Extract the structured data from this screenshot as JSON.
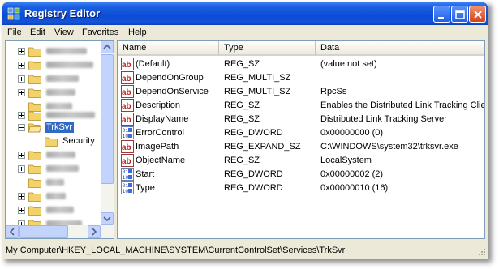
{
  "window": {
    "title": "Registry Editor",
    "title_color": "#ffffff",
    "titlebar_color": "#0a4cd6"
  },
  "menu": [
    "File",
    "Edit",
    "View",
    "Favorites",
    "Help"
  ],
  "tree": {
    "selected_key": "TrkSvr",
    "child_key": "Security",
    "selection_color": "#316ac5",
    "note": ""
  },
  "list": {
    "columns": [
      "Name",
      "Type",
      "Data"
    ],
    "rows": [
      {
        "icon": "string-value-icon",
        "name": "(Default)",
        "type": "REG_SZ",
        "data": "(value not set)"
      },
      {
        "icon": "string-value-icon",
        "name": "DependOnGroup",
        "type": "REG_MULTI_SZ",
        "data": ""
      },
      {
        "icon": "string-value-icon",
        "name": "DependOnService",
        "type": "REG_MULTI_SZ",
        "data": "RpcSs"
      },
      {
        "icon": "string-value-icon",
        "name": "Description",
        "type": "REG_SZ",
        "data": "Enables the Distributed Link Tracking Client"
      },
      {
        "icon": "string-value-icon",
        "name": "DisplayName",
        "type": "REG_SZ",
        "data": "Distributed Link Tracking Server"
      },
      {
        "icon": "binary-value-icon",
        "name": "ErrorControl",
        "type": "REG_DWORD",
        "data": "0x00000000 (0)"
      },
      {
        "icon": "string-value-icon",
        "name": "ImagePath",
        "type": "REG_EXPAND_SZ",
        "data": "C:\\WINDOWS\\system32\\trksvr.exe"
      },
      {
        "icon": "string-value-icon",
        "name": "ObjectName",
        "type": "REG_SZ",
        "data": "LocalSystem"
      },
      {
        "icon": "binary-value-icon",
        "name": "Start",
        "type": "REG_DWORD",
        "data": "0x00000002 (2)"
      },
      {
        "icon": "binary-value-icon",
        "name": "Type",
        "type": "REG_DWORD",
        "data": "0x00000010 (16)"
      }
    ]
  },
  "status": {
    "path": "My Computer\\HKEY_LOCAL_MACHINE\\SYSTEM\\CurrentControlSet\\Services\\TrkSvr"
  }
}
